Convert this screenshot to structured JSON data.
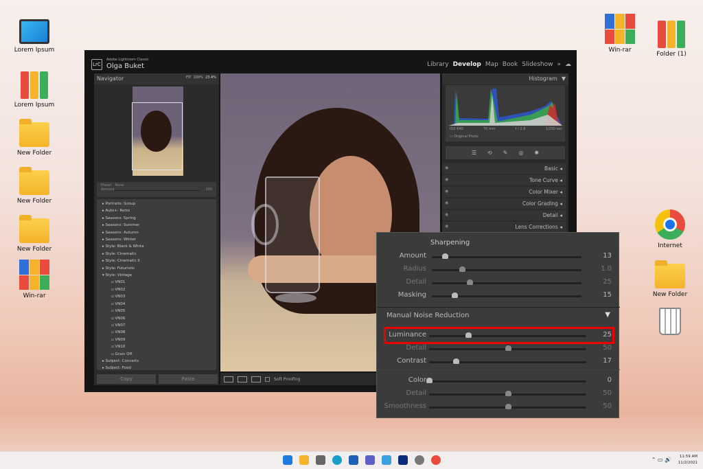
{
  "desktop": {
    "left_icons": [
      {
        "label": "Lorem Ipsum",
        "icon": "computer-icon"
      },
      {
        "label": "Lorem Ipsum",
        "icon": "binders-icon"
      },
      {
        "label": "New Folder",
        "icon": "folder-icon"
      },
      {
        "label": "New Folder",
        "icon": "folder-icon"
      },
      {
        "label": "New Folder",
        "icon": "folder-icon"
      },
      {
        "label": "Win-rar",
        "icon": "winrar-icon"
      }
    ],
    "right_icons": [
      {
        "label": "Win-rar",
        "icon": "winrar-icon"
      },
      {
        "label": "Folder (1)",
        "icon": "binders-icon"
      },
      {
        "label": "Internet",
        "icon": "chrome-icon"
      },
      {
        "label": "New Folder",
        "icon": "folder-icon"
      },
      {
        "label": "",
        "icon": "trash-icon"
      }
    ]
  },
  "app": {
    "logo": "LrC",
    "name": "Adobe Lightroom Classic",
    "user": "Olga Buket",
    "modules": [
      "Library",
      "Develop",
      "Map",
      "Book",
      "Slideshow",
      "»"
    ],
    "active_module": "Develop"
  },
  "navigator": {
    "title": "Navigator",
    "fit": "FIT",
    "zoom1": "100%",
    "zoom2": "23.4%"
  },
  "preset": {
    "label": "Preset",
    "value": "None",
    "amount_label": "Amount",
    "amount": "100"
  },
  "presets": [
    "Portraits: Group",
    "Auto+: Retro",
    "Seasons: Spring",
    "Seasons: Summer",
    "Seasons: Autumn",
    "Seasons: Winter",
    "Style: Black & White",
    "Style: Cinematic",
    "Style: Cinematic II",
    "Style: Futuristic",
    "Style: Vintage"
  ],
  "vintage": [
    "VN01",
    "VN02",
    "VN03",
    "VN04",
    "VN05",
    "VN06",
    "VN07",
    "VN08",
    "VN09",
    "VN10",
    "Grain Off"
  ],
  "presets_after": [
    "Subject: Concerts",
    "Subject: Food"
  ],
  "left_buttons": {
    "copy": "Copy",
    "paste": "Paste"
  },
  "photo_toolbar": {
    "soft_proofing": "Soft Proofing"
  },
  "histogram": {
    "title": "Histogram",
    "iso": "ISO 640",
    "focal": "70 mm",
    "aperture": "f / 2.8",
    "shutter": "1/200 sec",
    "original": "Original Photo"
  },
  "sections": [
    "Basic",
    "Tone Curve",
    "Color Mixer",
    "Color Grading",
    "Detail",
    "Lens Corrections"
  ],
  "detail_popup": {
    "sharpening_title": "Sharpening",
    "sharpening": [
      {
        "label": "Amount",
        "value": "13",
        "num": 13,
        "min": 0,
        "max": 150
      },
      {
        "label": "Radius",
        "value": "1.0",
        "num": 1.0,
        "min": 0.5,
        "max": 3.0
      },
      {
        "label": "Detail",
        "value": "25",
        "num": 25,
        "min": 0,
        "max": 100
      },
      {
        "label": "Masking",
        "value": "15",
        "num": 15,
        "min": 0,
        "max": 100
      }
    ],
    "noise_title": "Manual Noise Reduction",
    "noise": [
      {
        "label": "Luminance",
        "value": "25",
        "num": 25,
        "min": 0,
        "max": 100
      },
      {
        "label": "Detail",
        "value": "50",
        "num": 50,
        "min": 0,
        "max": 100
      },
      {
        "label": "Contrast",
        "value": "17",
        "num": 17,
        "min": 0,
        "max": 100
      },
      {
        "label": "Color",
        "value": "0",
        "num": 0,
        "min": 0,
        "max": 100
      },
      {
        "label": "Detail",
        "value": "50",
        "num": 50,
        "min": 0,
        "max": 100
      },
      {
        "label": "Smoothness",
        "value": "50",
        "num": 50,
        "min": 0,
        "max": 100
      }
    ],
    "highlight_color": "#e00000"
  },
  "taskbar": {
    "time": "11:59 AM",
    "date": "11/2/2021"
  }
}
